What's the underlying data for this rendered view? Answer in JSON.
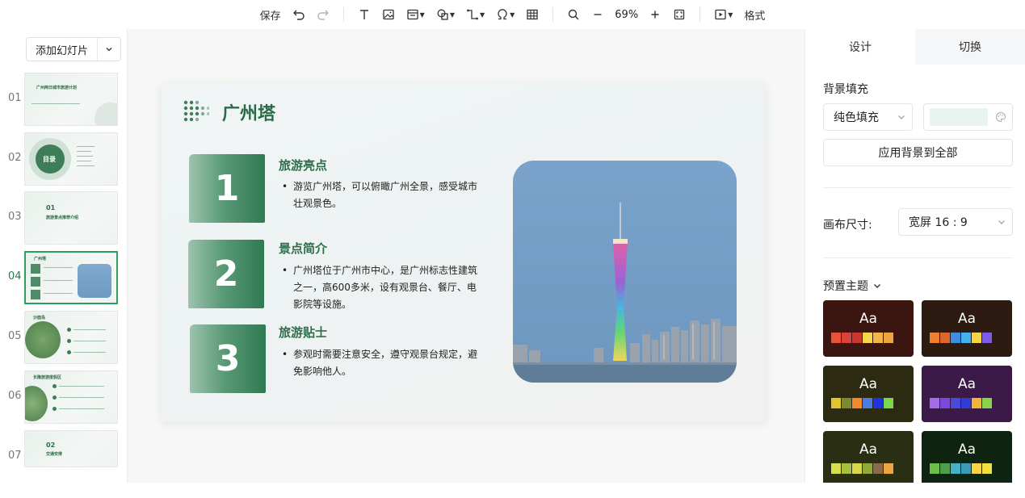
{
  "toolbar": {
    "save_label": "保存",
    "zoom_value": "69%",
    "format_label": "格式"
  },
  "left_panel": {
    "add_slide_label": "添加幻灯片",
    "slides": [
      {
        "num": "01",
        "title": "广州两日城市旅游计划"
      },
      {
        "num": "02",
        "title": "目录"
      },
      {
        "num": "03",
        "big": "01",
        "title": "旅游景点推荐介绍"
      },
      {
        "num": "04",
        "title": "广州塔"
      },
      {
        "num": "05",
        "title": "沙面岛"
      },
      {
        "num": "06",
        "title": "长隆旅游度假区"
      },
      {
        "num": "07",
        "big": "02",
        "title": "交通安排"
      }
    ],
    "active_index": 3
  },
  "slide": {
    "title": "广州塔",
    "sections": [
      {
        "number": "1",
        "title": "旅游亮点",
        "bullet": "•",
        "body": "游览广州塔，可以俯瞰广州全景，感受城市壮观景色。"
      },
      {
        "number": "2",
        "title": "景点简介",
        "bullet": "•",
        "body": "广州塔位于广州市中心，是广州标志性建筑之一，高600多米，设有观景台、餐厅、电影院等设施。"
      },
      {
        "number": "3",
        "title": "旅游贴士",
        "bullet": "•",
        "body": "参观时需要注意安全，遵守观景台规定，避免影响他人。"
      }
    ]
  },
  "right_panel": {
    "tabs": [
      "设计",
      "切换"
    ],
    "active_tab": "设计",
    "background_fill_label": "背景填充",
    "fill_type": "纯色填充",
    "fill_color": "#e9f3f2",
    "apply_bg_all_label": "应用背景到全部",
    "canvas_size_label": "画布尺寸:",
    "canvas_size_value": "宽屏 16 : 9",
    "preset_themes_label": "预置主题",
    "themes": [
      {
        "aa": "Aa",
        "bg": "#3b1510",
        "colors": [
          "#e8513a",
          "#d8433a",
          "#c9392f",
          "#f6d74a",
          "#f3b64a",
          "#f0a640"
        ]
      },
      {
        "aa": "Aa",
        "bg": "#2d1a10",
        "colors": [
          "#ef7d32",
          "#d96930",
          "#3e8ede",
          "#43b2e8",
          "#f6d445",
          "#7c5ce6"
        ]
      },
      {
        "aa": "Aa",
        "bg": "#2d2a12",
        "colors": [
          "#e3c12f",
          "#7b8a2f",
          "#f08a2d",
          "#4a7de3",
          "#2431e0",
          "#78d84a"
        ]
      },
      {
        "aa": "Aa",
        "bg": "#3b1a47",
        "colors": [
          "#a56be8",
          "#7a4ae0",
          "#4a4ad8",
          "#2f3dd6",
          "#f0b63a",
          "#8ad44a"
        ]
      },
      {
        "aa": "Aa",
        "bg": "#2a2e12",
        "colors": [
          "#d9df4a",
          "#a8c040",
          "#d8d84a",
          "#93a83a",
          "#8a6a4a",
          "#f0a640"
        ]
      },
      {
        "aa": "Aa",
        "bg": "#0e2410",
        "colors": [
          "#6cc04a",
          "#4aa04a",
          "#43b2c8",
          "#3a9ab8",
          "#f6d445",
          "#f0e040"
        ]
      }
    ]
  }
}
